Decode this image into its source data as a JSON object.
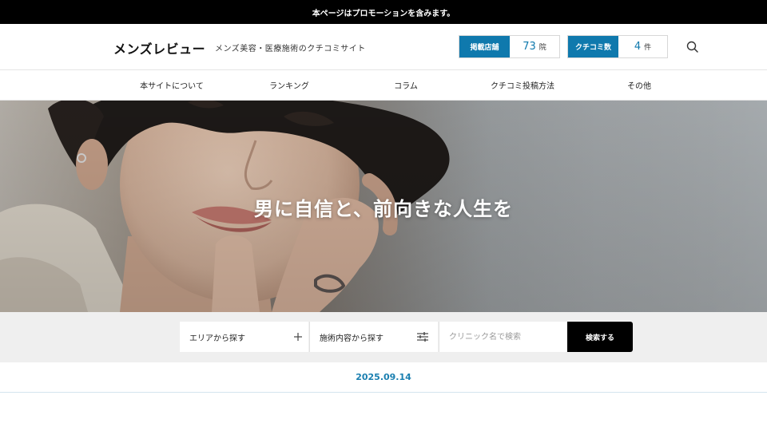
{
  "promo_banner": {
    "text": "本ページはプロモーションを含みます。"
  },
  "header": {
    "logo": "メンズレビュー",
    "tagline": "メンズ美容・医療施術のクチコミサイト",
    "stats": {
      "clinics": {
        "label": "掲載店舗",
        "value": "73",
        "unit": "院"
      },
      "reviews": {
        "label": "クチコミ数",
        "value": "4",
        "unit": "件"
      }
    },
    "search_icon": "search-icon"
  },
  "nav": {
    "items": [
      {
        "label": "本サイトについて"
      },
      {
        "label": "ランキング"
      },
      {
        "label": "コラム"
      },
      {
        "label": "クチコミ投稿方法"
      },
      {
        "label": "その他"
      }
    ]
  },
  "hero": {
    "headline": "男に自信と、前向きな人生を"
  },
  "search": {
    "area_label": "エリアから探す",
    "area_icon": "plus-icon",
    "treatment_label": "施術内容から探す",
    "treatment_icon": "sliders-icon",
    "clinic_placeholder": "クリニック名で検索",
    "submit_label": "検索する"
  },
  "latest": {
    "date": "2025.09.14"
  },
  "colors": {
    "accent": "#0f79ad",
    "date_text": "#1a7fb0",
    "banner_bg": "#000000",
    "search_bg": "#efefef"
  }
}
